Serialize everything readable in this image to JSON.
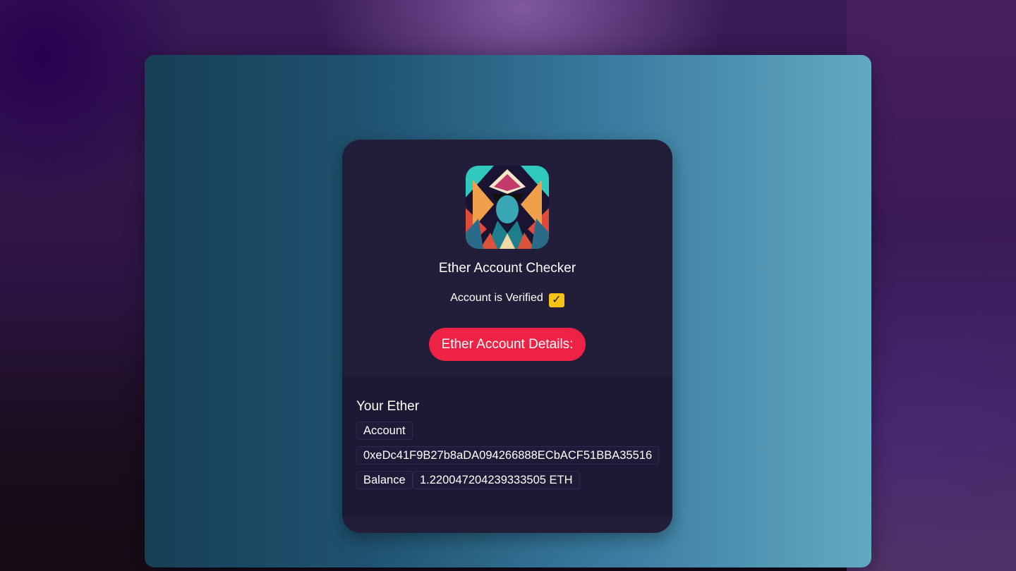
{
  "app": {
    "title": "Ether Account Checker"
  },
  "status": {
    "text": "Account is Verified",
    "icon": "check-box-icon",
    "icon_glyph": "✓",
    "icon_color": "#f5c216"
  },
  "actions": {
    "details_button_label": "Ether Account Details:",
    "details_button_color": "#ee2244"
  },
  "details": {
    "heading": "Your Ether",
    "account_label": "Account",
    "account_address": "0xeDc41F9B27b8aDA094266888ECbACF51BBA35516",
    "balance_label": "Balance",
    "balance_value": "1.220047204239333505 ETH"
  }
}
